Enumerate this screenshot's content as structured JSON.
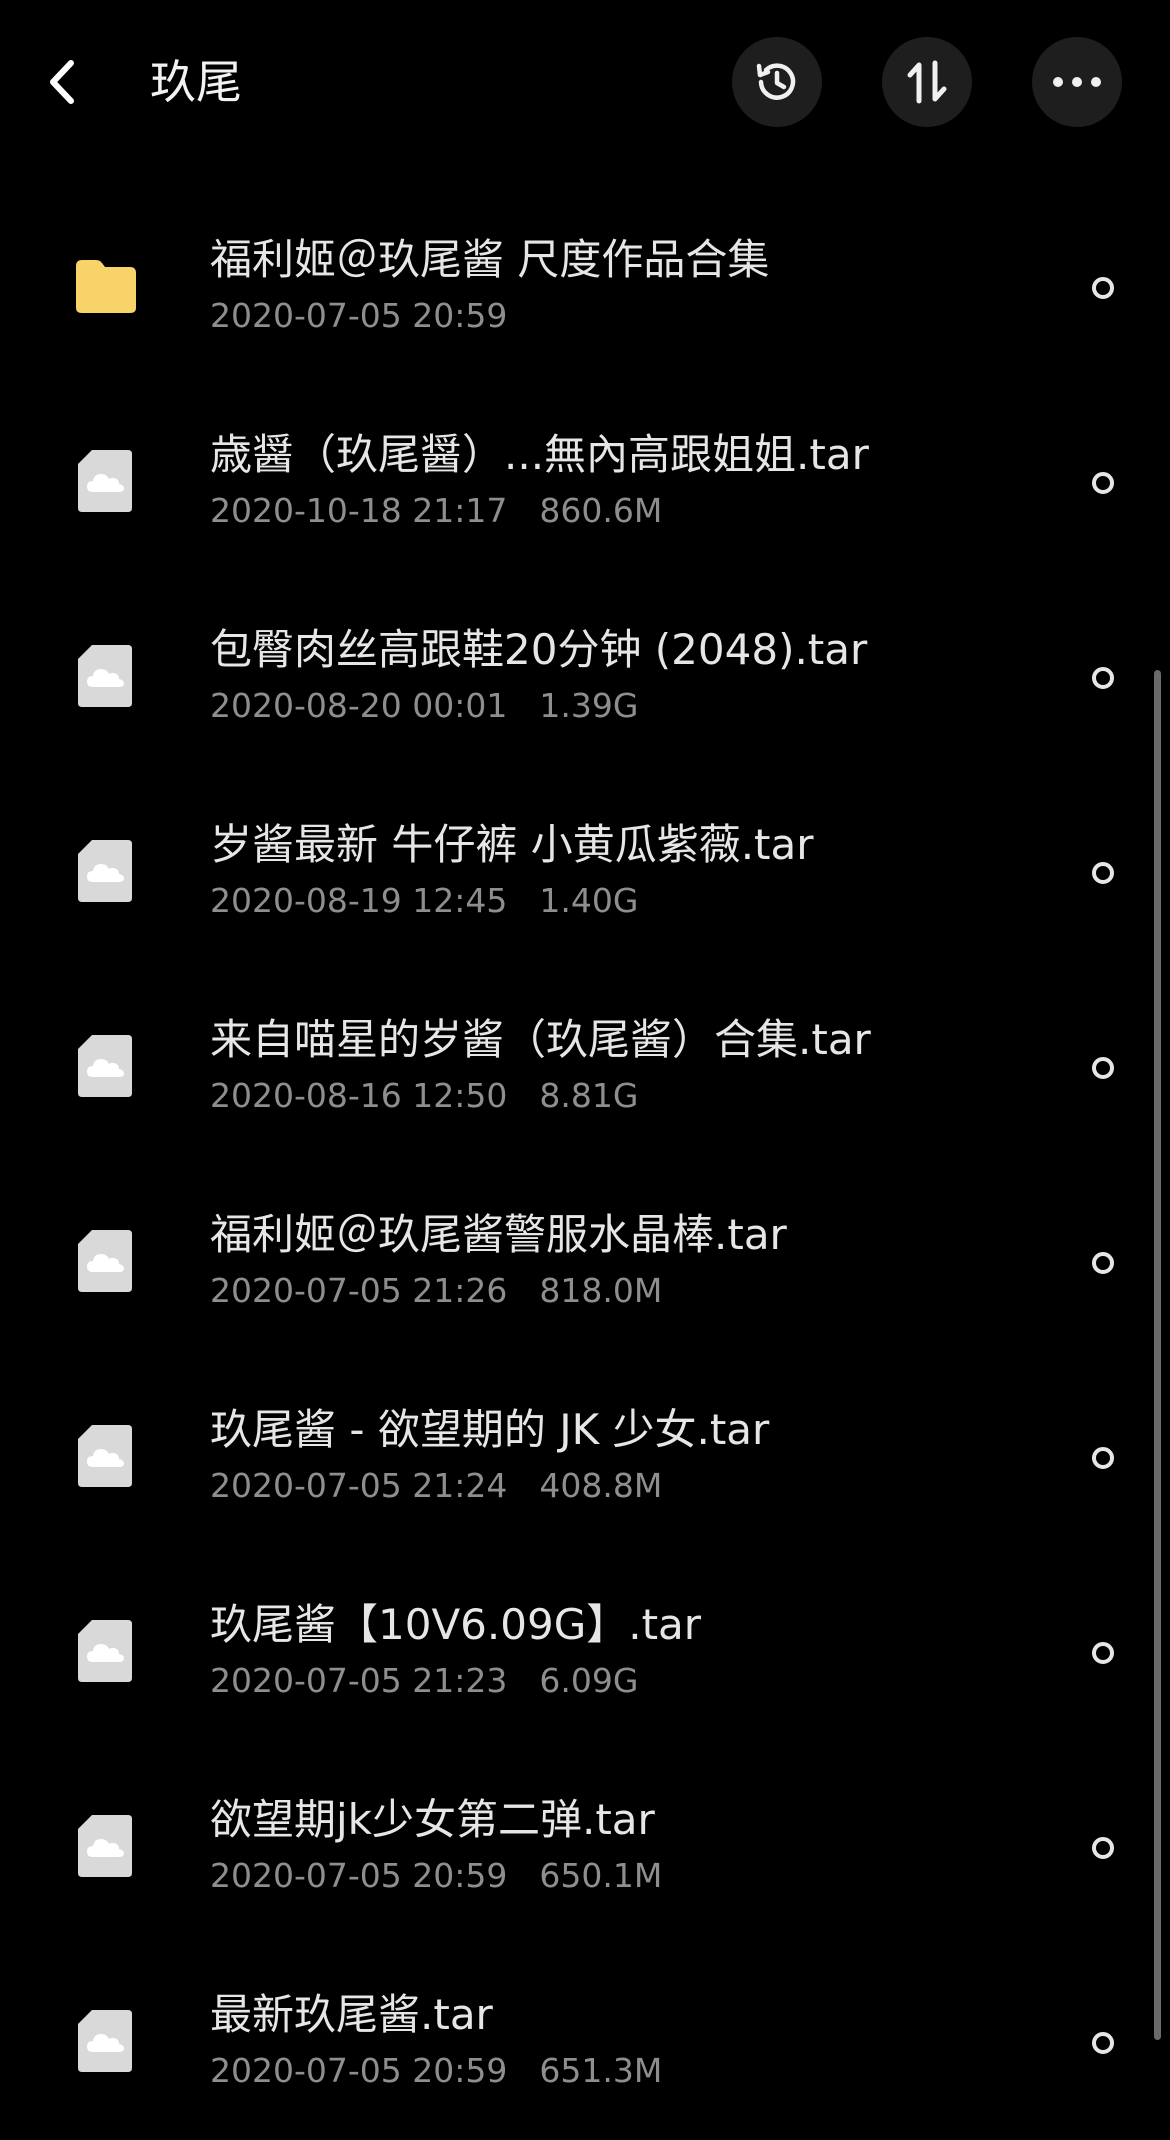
{
  "header": {
    "title": "玖尾",
    "back_icon": "chevron-left-icon",
    "history_icon": "history-clock-icon",
    "sort_icon": "sort-arrows-icon",
    "more_icon": "more-dots-icon"
  },
  "colors": {
    "background": "#000000",
    "folder": "#F7D36A",
    "file_icon": "#D9D9D9",
    "button_bg": "#1E1E1E"
  },
  "files": [
    {
      "type": "folder",
      "icon": "folder-icon",
      "name": "福利姬＠玖尾酱 尺度作品合集",
      "date": "2020-07-05 20:59",
      "size": ""
    },
    {
      "type": "file",
      "icon": "cloud-file-icon",
      "name": "歳醤（玖尾醤）...無內高跟姐姐.tar",
      "date": "2020-10-18 21:17",
      "size": "860.6M"
    },
    {
      "type": "file",
      "icon": "cloud-file-icon",
      "name": "包臀肉丝高跟鞋20分钟 (2048).tar",
      "date": "2020-08-20 00:01",
      "size": "1.39G"
    },
    {
      "type": "file",
      "icon": "cloud-file-icon",
      "name": "岁酱最新 牛仔裤 小黄瓜紫薇.tar",
      "date": "2020-08-19 12:45",
      "size": "1.40G"
    },
    {
      "type": "file",
      "icon": "cloud-file-icon",
      "name": "来自喵星的岁酱（玖尾酱）合集.tar",
      "date": "2020-08-16 12:50",
      "size": "8.81G"
    },
    {
      "type": "file",
      "icon": "cloud-file-icon",
      "name": "福利姬＠玖尾酱警服水晶棒.tar",
      "date": "2020-07-05 21:26",
      "size": "818.0M"
    },
    {
      "type": "file",
      "icon": "cloud-file-icon",
      "name": "玖尾酱 - 欲望期的 JK 少女.tar",
      "date": "2020-07-05 21:24",
      "size": "408.8M"
    },
    {
      "type": "file",
      "icon": "cloud-file-icon",
      "name": "玖尾酱【10V6.09G】.tar",
      "date": "2020-07-05 21:23",
      "size": "6.09G"
    },
    {
      "type": "file",
      "icon": "cloud-file-icon",
      "name": "欲望期jk少女第二弹.tar",
      "date": "2020-07-05 20:59",
      "size": "650.1M"
    },
    {
      "type": "file",
      "icon": "cloud-file-icon",
      "name": "最新玖尾酱.tar",
      "date": "2020-07-05 20:59",
      "size": "651.3M"
    }
  ]
}
